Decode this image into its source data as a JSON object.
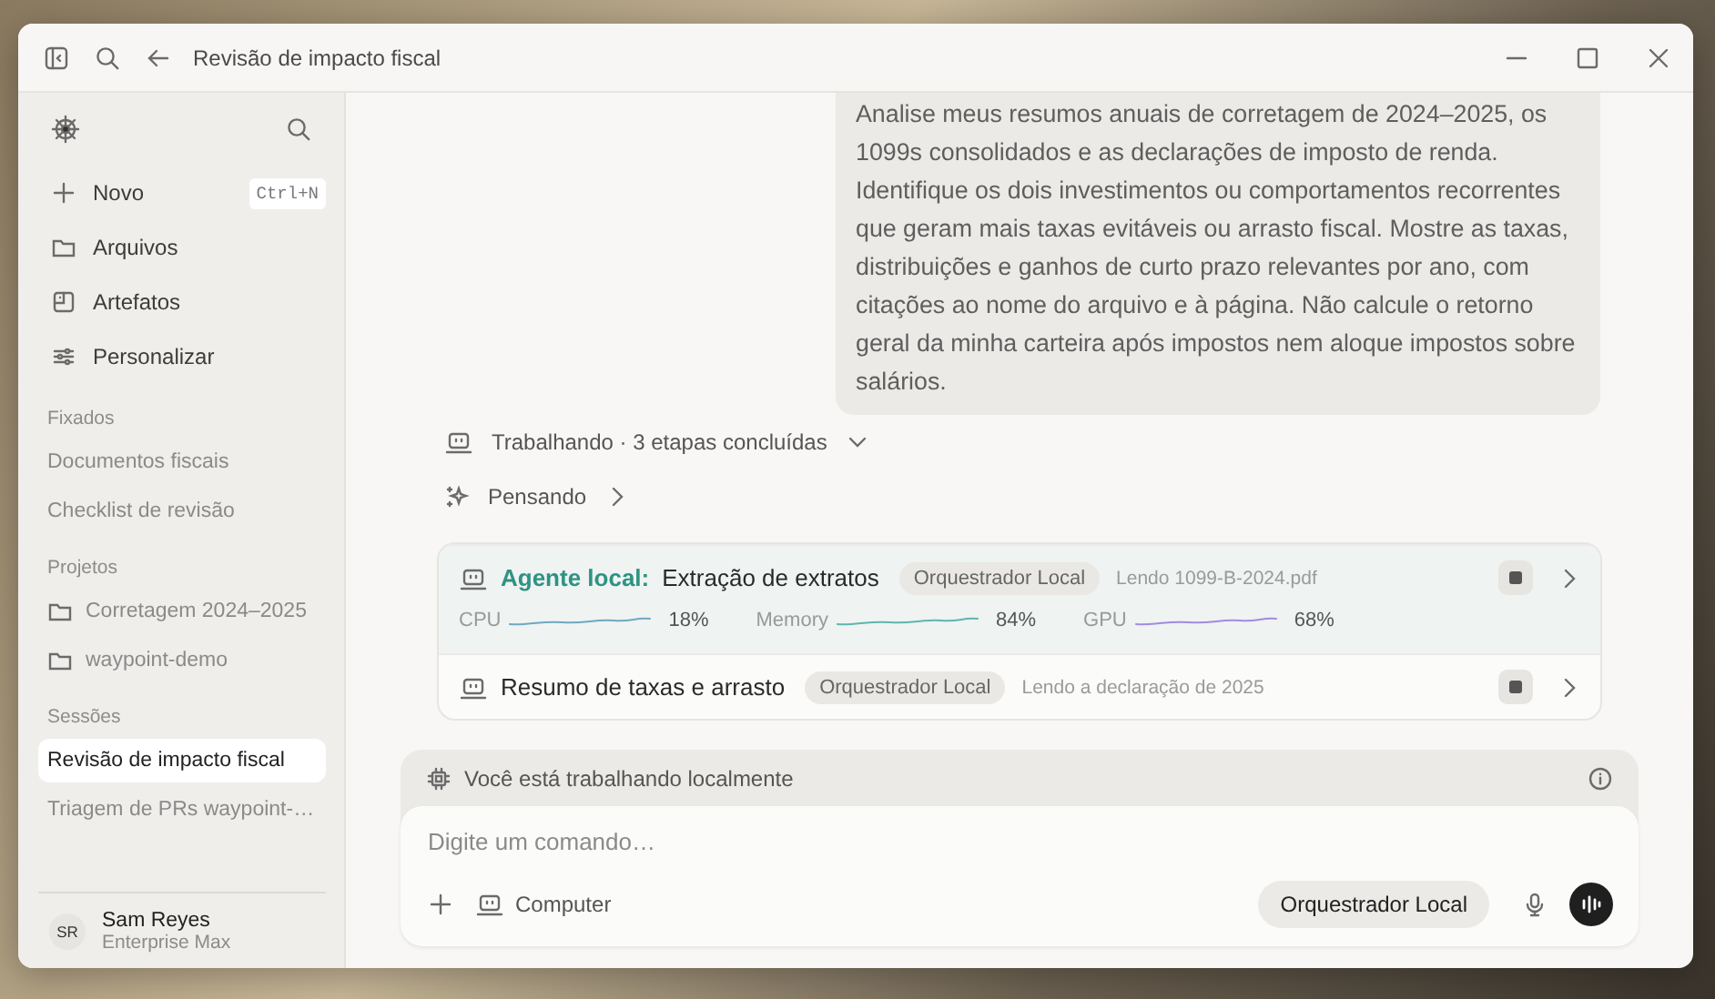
{
  "window": {
    "title": "Revisão de impacto fiscal"
  },
  "sidebar": {
    "nav": [
      {
        "label": "Novo",
        "shortcut": "Ctrl+N"
      },
      {
        "label": "Arquivos"
      },
      {
        "label": "Artefatos"
      },
      {
        "label": "Personalizar"
      }
    ],
    "sections": [
      {
        "title": "Fixados",
        "items": [
          {
            "label": "Documentos fiscais",
            "kind": "link",
            "selected": false
          },
          {
            "label": "Checklist de revisão",
            "kind": "link",
            "selected": false
          }
        ]
      },
      {
        "title": "Projetos",
        "items": [
          {
            "label": "Corretagem 2024–2025",
            "kind": "folder",
            "selected": false
          },
          {
            "label": "waypoint-demo",
            "kind": "folder",
            "selected": false
          }
        ]
      },
      {
        "title": "Sessões",
        "items": [
          {
            "label": "Revisão de impacto fiscal",
            "kind": "link",
            "selected": true
          },
          {
            "label": "Triagem de PRs waypoint-…",
            "kind": "link",
            "selected": false
          }
        ]
      }
    ],
    "user": {
      "initials": "SR",
      "name": "Sam Reyes",
      "plan": "Enterprise Max"
    }
  },
  "chat": {
    "message": "Analise meus resumos anuais de corretagem de 2024–2025, os 1099s consolidados e as declarações de imposto de renda. Identifique os dois investimentos ou comportamentos recorrentes que geram mais taxas evitáveis ou arrasto fiscal. Mostre as taxas, distribuições e ganhos de curto prazo relevantes por ano, com citações ao nome do arquivo e à página. Não calcule o retorno geral da minha carteira após impostos nem aloque impostos sobre salários.",
    "steps": [
      {
        "kind": "working",
        "text": "Trabalhando · 3 etapas concluídas"
      },
      {
        "kind": "thinking",
        "text": "Pensando"
      }
    ],
    "tasks": [
      {
        "agent": "Agente local:",
        "title": "Extração de extratos",
        "badge": "Orquestrador Local",
        "status": "Lendo 1099-B-2024.pdf",
        "expanded": true,
        "metrics": [
          {
            "label": "CPU",
            "reading": "18%",
            "color": "#6fa8c0"
          },
          {
            "label": "Memory",
            "reading": "84%",
            "color": "#5fb5ae"
          },
          {
            "label": "GPU",
            "reading": "68%",
            "color": "#a48ae0"
          }
        ]
      },
      {
        "title": "Resumo de taxas e arrasto",
        "badge": "Orquestrador Local",
        "status": "Lendo a declaração de 2025",
        "expanded": false
      }
    ]
  },
  "composer": {
    "notice": "Você está trabalhando localmente",
    "placeholder": "Digite um comando…",
    "tool": "Computer",
    "model": "Orquestrador Local"
  }
}
